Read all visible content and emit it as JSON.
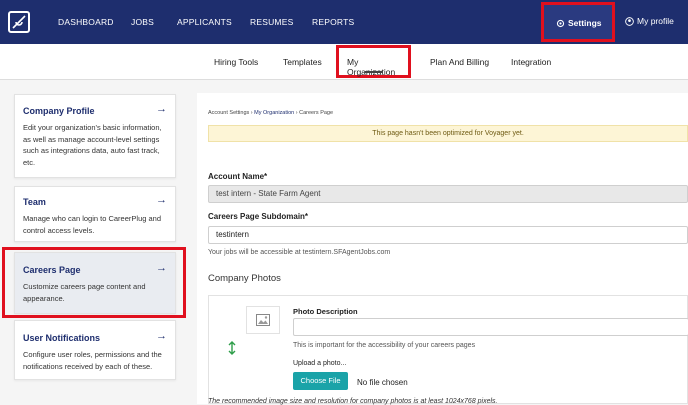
{
  "topnav": {
    "links": [
      "DASHBOARD",
      "JOBS",
      "APPLICANTS",
      "RESUMES",
      "REPORTS"
    ],
    "settings_label": "Settings",
    "profile_label": "My profile"
  },
  "subnav": {
    "tabs": [
      "Hiring Tools",
      "Templates",
      "My Organization",
      "Plan And Billing",
      "Integration"
    ]
  },
  "sidebar": {
    "cards": [
      {
        "title": "Company Profile",
        "desc": "Edit your organization's basic information, as well as manage account-level settings such as integrations data, auto fast track, etc."
      },
      {
        "title": "Team",
        "desc": "Manage who can login to CareerPlug and control access levels."
      },
      {
        "title": "Careers Page",
        "desc": "Customize careers page content and appearance."
      },
      {
        "title": "User Notifications",
        "desc": "Configure user roles, permissions and the notifications received by each of these."
      }
    ],
    "arrow": "→"
  },
  "main": {
    "crumbs": {
      "a": "Account Settings",
      "sep": " › ",
      "b": "My Organization",
      "c": "Careers Page"
    },
    "banner": "This page hasn't been optimized for Voyager yet.",
    "account_label": "Account Name*",
    "account_value": "test intern - State Farm Agent",
    "subdomain_label": "Careers Page Subdomain*",
    "subdomain_value": "testintern",
    "subdomain_hint": "Your jobs will be accessible at testintern.SFAgentJobs.com",
    "photos_title": "Company Photos",
    "photo_desc_label": "Photo Description",
    "photo_desc_hint": "This is important for the accessibility of your careers pages",
    "upload_label": "Upload a photo...",
    "choose_file": "Choose File",
    "no_file": "No file chosen",
    "recommend": "The recommended image size and resolution for company photos is at least 1024x768 pixels."
  },
  "colors": {
    "nav_bg": "#1e2e6e",
    "highlight": "#e0101e",
    "accent": "#1aa3a8"
  }
}
